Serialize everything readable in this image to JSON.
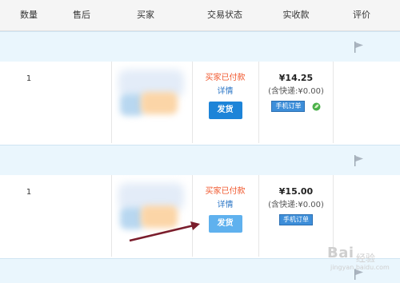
{
  "header": {
    "qty": "数量",
    "after_sales": "售后",
    "buyer": "买家",
    "trade_status": "交易状态",
    "received": "实收款",
    "rating": "评价"
  },
  "orders": [
    {
      "qty": "1",
      "status": "买家已付款",
      "detail": "详情",
      "ship_button": "发货",
      "price": "¥14.25",
      "shipping_fee": "(含快递:¥0.00)",
      "mobile_badge": "手机订单"
    },
    {
      "qty": "1",
      "status": "买家已付款",
      "detail": "详情",
      "ship_button": "发货",
      "price": "¥15.00",
      "shipping_fee": "(含快递:¥0.00)",
      "mobile_badge": "手机订单"
    }
  ],
  "watermark": {
    "brand": "Bai",
    "suffix": "经验",
    "url": "jingyan.baidu.com"
  },
  "colors": {
    "band": "#eaf6fd",
    "status_red": "#f0562b",
    "link_blue": "#2b76c6",
    "button_blue": "#1d84d8",
    "arrow": "#7a1d2c"
  }
}
